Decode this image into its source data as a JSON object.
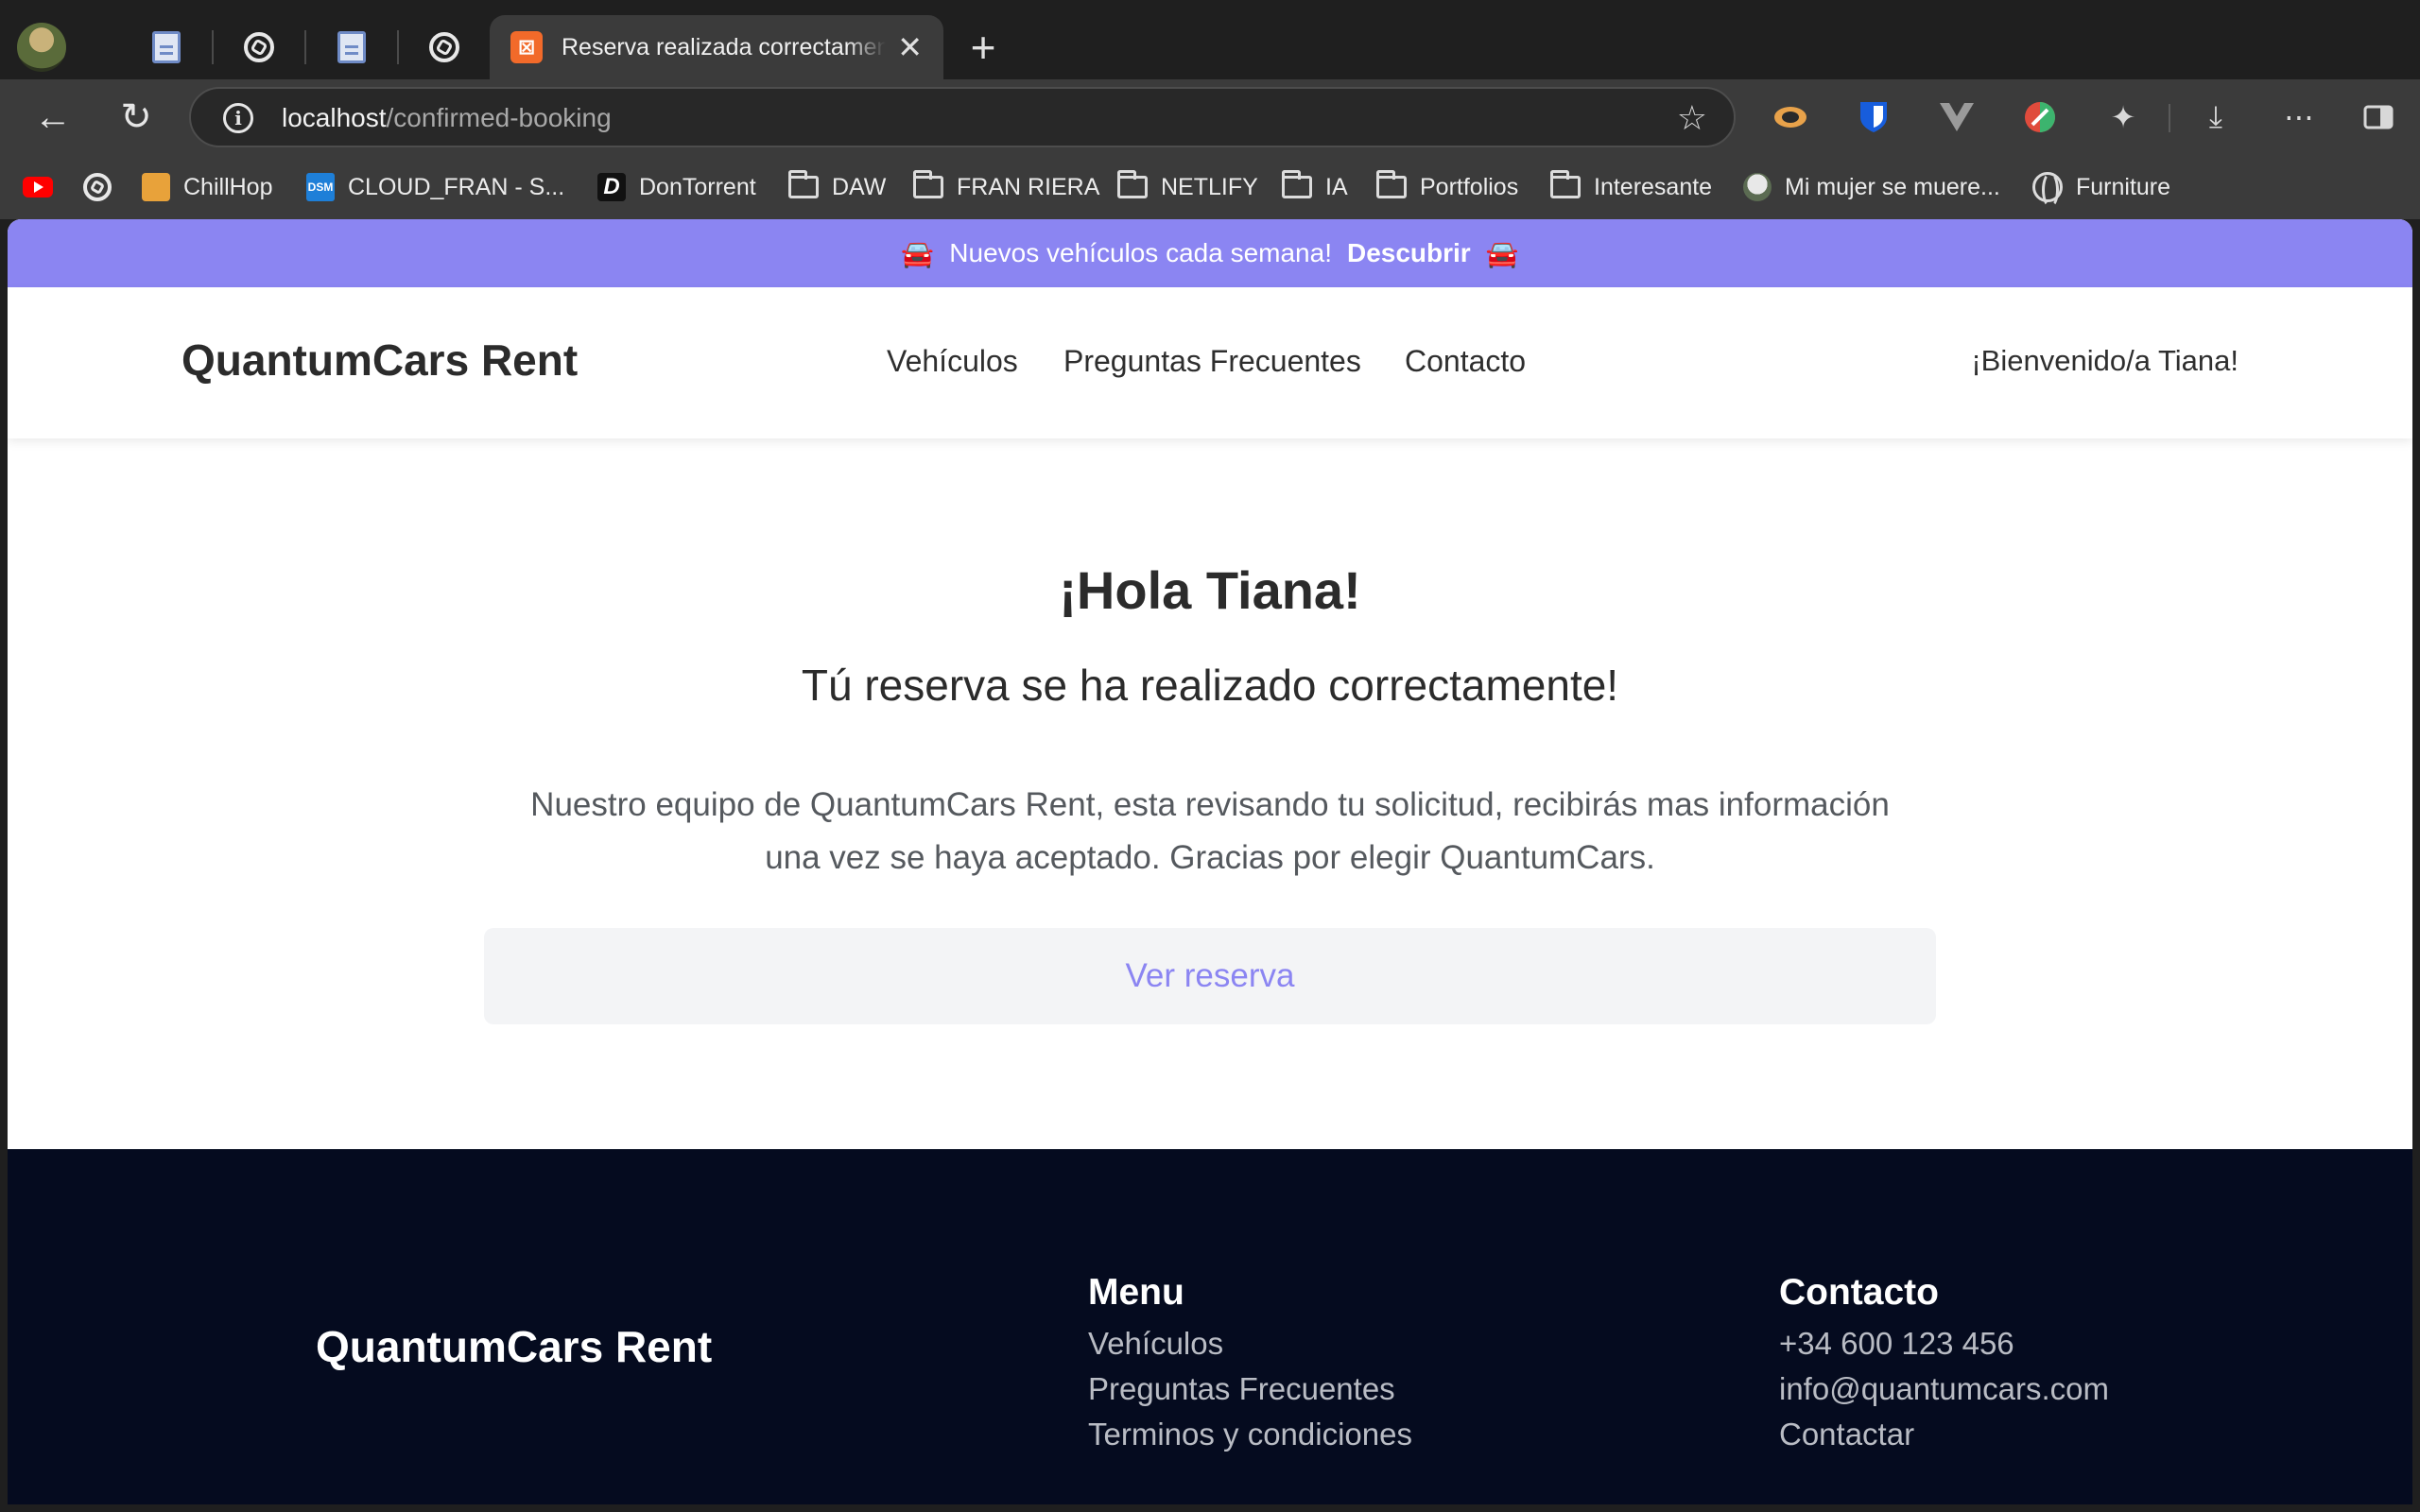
{
  "browser": {
    "active_tab_title": "Reserva realizada correctamente",
    "new_tab_label": "+",
    "url_host": "localhost",
    "url_path": "/confirmed-booking",
    "bookmarks": [
      {
        "label": "",
        "icon": "youtube-icon"
      },
      {
        "label": "",
        "icon": "openai-icon"
      },
      {
        "label": "ChillHop",
        "icon": "chillhop-icon"
      },
      {
        "label": "CLOUD_FRAN - S...",
        "icon": "dsm-icon"
      },
      {
        "label": "DonTorrent",
        "icon": "dontorrent-icon"
      },
      {
        "label": "DAW",
        "icon": "folder-icon"
      },
      {
        "label": "FRAN RIERA",
        "icon": "folder-icon"
      },
      {
        "label": "NETLIFY",
        "icon": "folder-icon"
      },
      {
        "label": "IA",
        "icon": "folder-icon"
      },
      {
        "label": "Portfolios",
        "icon": "folder-icon"
      },
      {
        "label": "Interesante",
        "icon": "folder-icon"
      },
      {
        "label": "Mi mujer se muere...",
        "icon": "site-icon"
      },
      {
        "label": "Furniture",
        "icon": "globe-icon"
      }
    ]
  },
  "promo": {
    "text": "Nuevos vehículos cada semana!",
    "link": "Descubrir",
    "emoji": "🚘"
  },
  "header": {
    "brand": "QuantumCars Rent",
    "nav": [
      "Vehículos",
      "Preguntas Frecuentes",
      "Contacto"
    ],
    "welcome": "¡Bienvenido/a Tiana!"
  },
  "main": {
    "greeting": "¡Hola Tiana!",
    "subtitle": "Tú reserva se ha realizado correctamente!",
    "message_line1": "Nuestro equipo de QuantumCars Rent, esta revisando tu solicitud, recibirás mas información",
    "message_line2": "una vez se haya aceptado. Gracias por elegir QuantumCars.",
    "cta": "Ver reserva"
  },
  "footer": {
    "brand": "QuantumCars Rent",
    "menu_title": "Menu",
    "menu_items": [
      "Vehículos",
      "Preguntas Frecuentes",
      "Terminos y condiciones"
    ],
    "contact_title": "Contacto",
    "contact_items": [
      "+34 600 123 456",
      "info@quantumcars.com",
      "Contactar"
    ]
  },
  "colors": {
    "accent": "#8b85f2",
    "footer_bg": "#050b1f",
    "cta_bg": "#f3f4f6"
  }
}
